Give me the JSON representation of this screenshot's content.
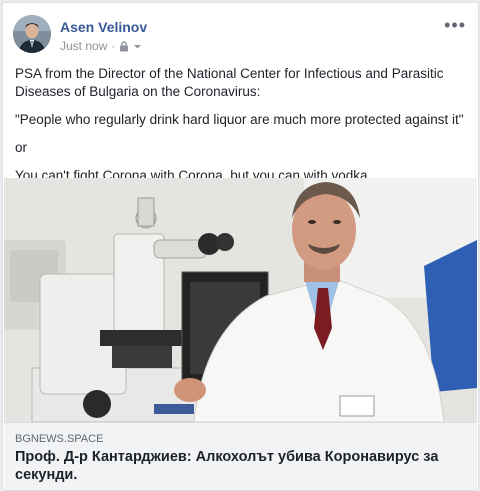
{
  "post": {
    "author": "Asen Velinov",
    "timestamp": "Just now",
    "privacy_icon": "lock-icon",
    "more_icon": "more-options-icon",
    "more_label": "•••",
    "text_lines": [
      "PSA from the Director of the National Center for Infectious and Parasitic Diseases of Bulgaria on the Coronavirus:",
      "\"People who regularly drink hard liquor are much more protected against it\"",
      "or",
      "You can't fight Corona with Corona, but you can with vodka."
    ]
  },
  "link_preview": {
    "domain": "BGNEWS.SPACE",
    "title": "Проф. Д-р Кантарджиев: Алкохолът убива Коронавирус за секунди."
  },
  "colors": {
    "author_link": "#385898",
    "text": "#1d2129",
    "meta": "#90949c",
    "link_box_bg": "#f2f3f5"
  }
}
